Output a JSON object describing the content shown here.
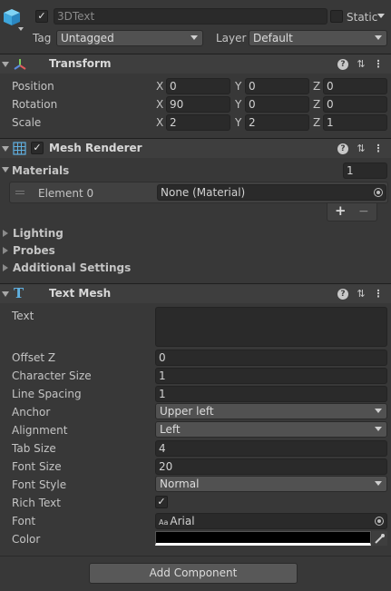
{
  "gameobject": {
    "name": "3DText",
    "static_label": "Static",
    "tag_label": "Tag",
    "tag_value": "Untagged",
    "layer_label": "Layer",
    "layer_value": "Default",
    "active_checked": "✓"
  },
  "transform": {
    "title": "Transform",
    "position_label": "Position",
    "rotation_label": "Rotation",
    "scale_label": "Scale",
    "position": {
      "x": "0",
      "y": "0",
      "z": "0"
    },
    "rotation": {
      "x": "90",
      "y": "0",
      "z": "0"
    },
    "scale": {
      "x": "2",
      "y": "2",
      "z": "1"
    },
    "axis_x": "X",
    "axis_y": "Y",
    "axis_z": "Z"
  },
  "mesh_renderer": {
    "title": "Mesh Renderer",
    "materials_label": "Materials",
    "materials_count": "1",
    "element_label": "Element 0",
    "element_value": "None (Material)",
    "add_label": "+",
    "remove_label": "−",
    "lighting_label": "Lighting",
    "probes_label": "Probes",
    "additional_label": "Additional Settings"
  },
  "text_mesh": {
    "title": "Text Mesh",
    "text_label": "Text",
    "text_value": "",
    "fields": [
      {
        "label": "Offset Z",
        "value": "0"
      },
      {
        "label": "Character Size",
        "value": "1"
      },
      {
        "label": "Line Spacing",
        "value": "1"
      },
      {
        "label": "Anchor",
        "value": "Upper left"
      },
      {
        "label": "Alignment",
        "value": "Left"
      },
      {
        "label": "Tab Size",
        "value": "4"
      },
      {
        "label": "Font Size",
        "value": "20"
      },
      {
        "label": "Font Style",
        "value": "Normal"
      },
      {
        "label": "Rich Text",
        "value": "✓"
      },
      {
        "label": "Font",
        "value": "Arial"
      },
      {
        "label": "Color",
        "value": ""
      }
    ],
    "font_prefix": "Aa"
  },
  "add_component_label": "Add Component",
  "icons": {
    "help": "?",
    "settings": "⇅",
    "more": "⋮"
  }
}
